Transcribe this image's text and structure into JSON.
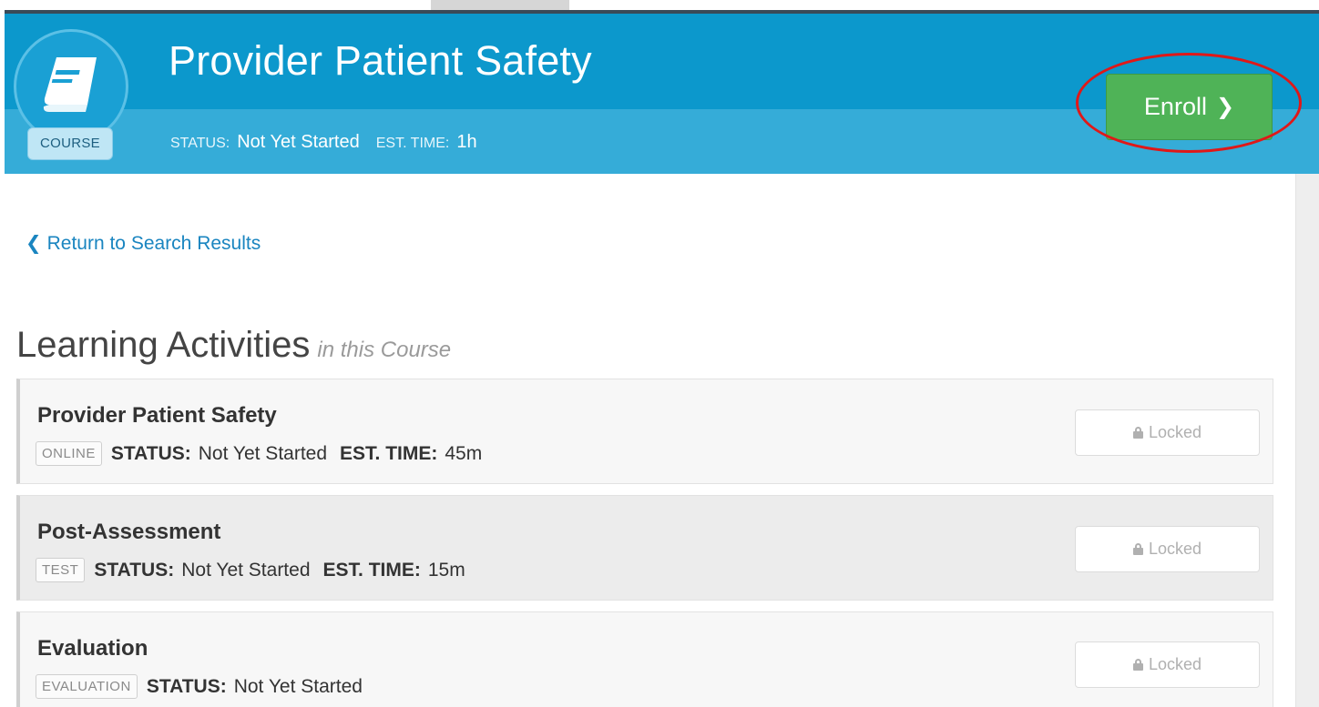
{
  "header": {
    "course_badge": "COURSE",
    "title": "Provider Patient Safety",
    "status_label": "STATUS:",
    "status_value": "Not Yet Started",
    "time_label": "EST. TIME:",
    "time_value": "1h",
    "enroll_label": "Enroll",
    "enroll_chevron": "❯",
    "icon": "book-icon"
  },
  "nav": {
    "return_chevron": "❮",
    "return_label": "Return to Search Results"
  },
  "section": {
    "title": "Learning Activities",
    "subtitle": "in this Course"
  },
  "activities": [
    {
      "name": "Provider Patient Safety",
      "type": "ONLINE",
      "status_label": "STATUS:",
      "status_value": "Not Yet Started",
      "time_label": "EST. TIME:",
      "time_value": "45m",
      "action_label": "Locked"
    },
    {
      "name": "Post-Assessment",
      "type": "TEST",
      "status_label": "STATUS:",
      "status_value": "Not Yet Started",
      "time_label": "EST. TIME:",
      "time_value": "15m",
      "action_label": "Locked"
    },
    {
      "name": "Evaluation",
      "type": "EVALUATION",
      "status_label": "STATUS:",
      "status_value": "Not Yet Started",
      "action_label": "Locked"
    }
  ],
  "colors": {
    "header_bg": "#0c98cc",
    "header_sub_bg": "#35acd8",
    "enroll_green": "#4fb357",
    "highlight_red": "#e01818",
    "link_blue": "#1a85c0"
  }
}
